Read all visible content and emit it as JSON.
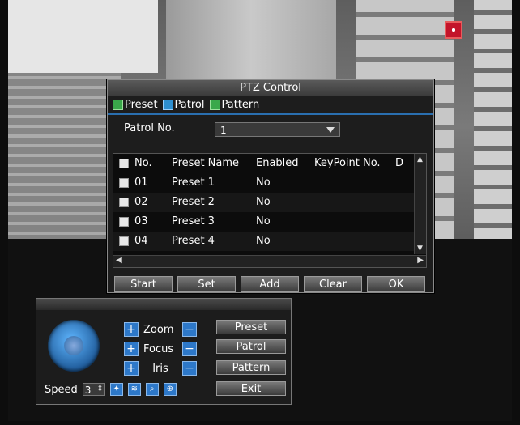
{
  "dialog": {
    "title": "PTZ Control",
    "tabs": [
      {
        "label": "Preset",
        "active": false
      },
      {
        "label": "Patrol",
        "active": true
      },
      {
        "label": "Pattern",
        "active": false
      }
    ],
    "patrol_label": "Patrol No.",
    "patrol_value": "1",
    "table": {
      "headers": [
        "No.",
        "Preset Name",
        "Enabled",
        "KeyPoint No.",
        "D"
      ],
      "rows": [
        {
          "no": "01",
          "name": "Preset 1",
          "enabled": "No"
        },
        {
          "no": "02",
          "name": "Preset 2",
          "enabled": "No"
        },
        {
          "no": "03",
          "name": "Preset 3",
          "enabled": "No"
        },
        {
          "no": "04",
          "name": "Preset 4",
          "enabled": "No"
        }
      ]
    },
    "buttons": {
      "start": "Start",
      "set": "Set",
      "add": "Add",
      "clear": "Clear",
      "ok": "OK"
    }
  },
  "panel": {
    "zoom": "Zoom",
    "focus": "Focus",
    "iris": "Iris",
    "preset_btn": "Preset",
    "patrol_btn": "Patrol",
    "pattern_btn": "Pattern",
    "exit_btn": "Exit",
    "speed_label": "Speed",
    "speed_value": "3"
  },
  "colors": {
    "accent": "#2d78c9",
    "record": "#c3142a"
  }
}
